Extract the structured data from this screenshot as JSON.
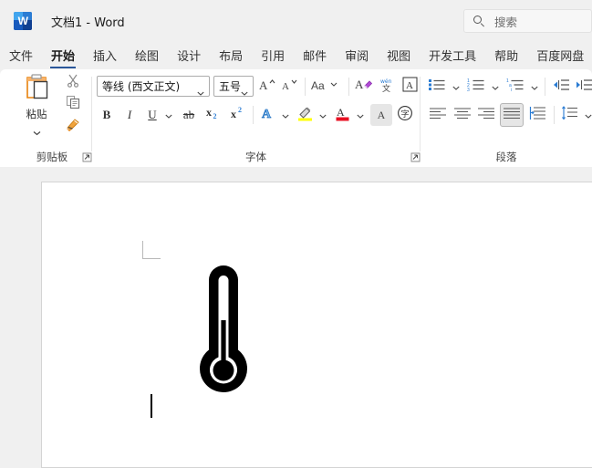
{
  "titlebar": {
    "app_icon": "word-icon",
    "document_title": "文档1  -  Word"
  },
  "search": {
    "icon": "search-icon",
    "placeholder": "搜索",
    "value": ""
  },
  "tabs": [
    {
      "label": "文件",
      "active": false
    },
    {
      "label": "开始",
      "active": true
    },
    {
      "label": "插入",
      "active": false
    },
    {
      "label": "绘图",
      "active": false
    },
    {
      "label": "设计",
      "active": false
    },
    {
      "label": "布局",
      "active": false
    },
    {
      "label": "引用",
      "active": false
    },
    {
      "label": "邮件",
      "active": false
    },
    {
      "label": "审阅",
      "active": false
    },
    {
      "label": "视图",
      "active": false
    },
    {
      "label": "开发工具",
      "active": false
    },
    {
      "label": "帮助",
      "active": false
    },
    {
      "label": "百度网盘",
      "active": false
    }
  ],
  "ribbon": {
    "clipboard": {
      "group_label": "剪贴板",
      "paste_label": "粘贴",
      "paste_icon": "paste-icon",
      "paste_dropdown_icon": "chevron-down-icon",
      "cut_icon": "scissors-icon",
      "copy_icon": "copy-icon",
      "format_painter_icon": "format-painter-icon",
      "dialog_launcher_icon": "dialog-launcher-icon"
    },
    "font": {
      "group_label": "字体",
      "font_name": "等线 (西文正文)",
      "font_size": "五号",
      "grow_font_icon": "grow-font-icon",
      "shrink_font_icon": "shrink-font-icon",
      "change_case_label": "Aa",
      "change_case_icon": "change-case-icon",
      "clear_formatting_icon": "clear-formatting-icon",
      "phonetic_guide_label": "wén",
      "phonetic_guide_sub": "文",
      "phonetic_guide_icon": "phonetic-guide-icon",
      "character_border_label": "A",
      "character_border_icon": "character-border-icon",
      "bold_label": "B",
      "italic_label": "I",
      "underline_label": "U",
      "underline_dropdown_icon": "chevron-down-icon",
      "strikethrough_label": "ab",
      "subscript_label": "x",
      "subscript_sub": "2",
      "superscript_label": "x",
      "superscript_sup": "2",
      "text_effects_label": "A",
      "text_effects_icon": "text-effects-icon",
      "highlight_icon": "highlight-color-icon",
      "highlight_color": "#ffff00",
      "font_color_label": "A",
      "font_color_icon": "font-color-icon",
      "font_color": "#e81123",
      "character_shading_label": "A",
      "character_shading_icon": "character-shading-icon",
      "enclose_characters_label": "字",
      "enclose_characters_icon": "enclose-characters-icon",
      "dialog_launcher_icon": "dialog-launcher-icon"
    },
    "paragraph": {
      "group_label": "段落",
      "bullets_icon": "bullet-list-icon",
      "numbering_icon": "numbered-list-icon",
      "multilevel_icon": "multilevel-list-icon",
      "decrease_indent_icon": "decrease-indent-icon",
      "increase_indent_icon": "increase-indent-icon",
      "align_left_icon": "align-left-icon",
      "align_center_icon": "align-center-icon",
      "align_right_icon": "align-right-icon",
      "justify_icon": "justify-icon",
      "distribute_icon": "distributed-align-icon",
      "line_spacing_icon": "line-spacing-icon",
      "dropdown_icon": "chevron-down-icon"
    },
    "accent_color": "#2b579a"
  },
  "document": {
    "content_glyph": "thermometer-icon",
    "caret_visible": true,
    "page_background": "#ffffff"
  }
}
